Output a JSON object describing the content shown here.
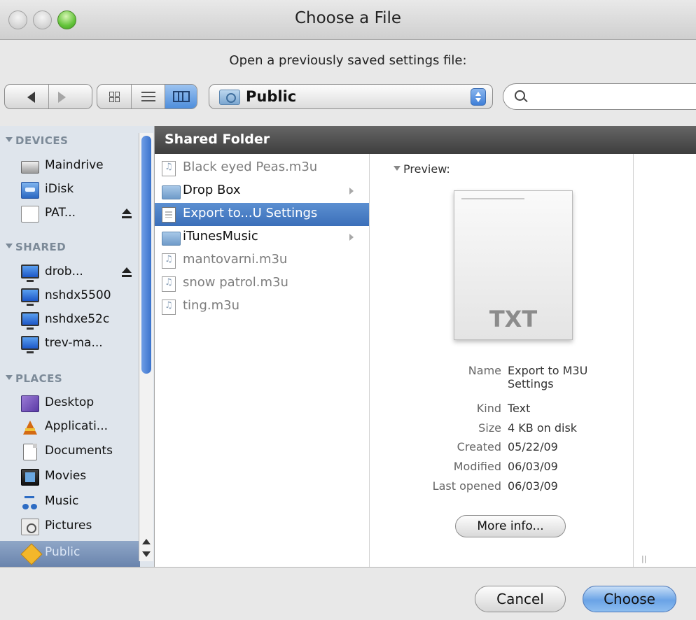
{
  "window": {
    "title": "Choose a File"
  },
  "prompt": "Open a previously saved settings file:",
  "toolbar": {
    "location": "Public",
    "search_value": ""
  },
  "sidebar": {
    "sections": {
      "devices": "DEVICES",
      "shared": "SHARED",
      "places": "PLACES"
    },
    "devices": [
      "Maindrive",
      "iDisk",
      "PAT..."
    ],
    "shared": [
      "drob...",
      "nshdx5500",
      "nshdxe52c",
      "trev-ma..."
    ],
    "places": [
      "Desktop",
      "Applicati...",
      "Documents",
      "Movies",
      "Music",
      "Pictures",
      "Public"
    ]
  },
  "browser": {
    "column_header": "Shared Folder",
    "files": [
      {
        "name": "Black eyed Peas.m3u",
        "kind": "m3u"
      },
      {
        "name": "Drop Box",
        "kind": "folder"
      },
      {
        "name": "Export to...U Settings",
        "kind": "txt",
        "selected": true
      },
      {
        "name": "iTunesMusic",
        "kind": "folder"
      },
      {
        "name": "mantovarni.m3u",
        "kind": "m3u"
      },
      {
        "name": "snow patrol.m3u",
        "kind": "m3u"
      },
      {
        "name": "ting.m3u",
        "kind": "m3u"
      }
    ]
  },
  "preview": {
    "label": "Preview:",
    "thumb_text": "TXT",
    "name_label": "Name",
    "name_value": "Export to M3U Settings",
    "kind_label": "Kind",
    "kind_value": "Text",
    "size_label": "Size",
    "size_value": "4 KB on disk",
    "created_label": "Created",
    "created_value": "05/22/09",
    "modified_label": "Modified",
    "modified_value": "06/03/09",
    "opened_label": "Last opened",
    "opened_value": "06/03/09",
    "more_info": "More info..."
  },
  "buttons": {
    "cancel": "Cancel",
    "choose": "Choose"
  },
  "colors": {
    "selection": "#3b6fb9",
    "header": "#4a4a4a",
    "sidebar": "#dfe5ec"
  }
}
